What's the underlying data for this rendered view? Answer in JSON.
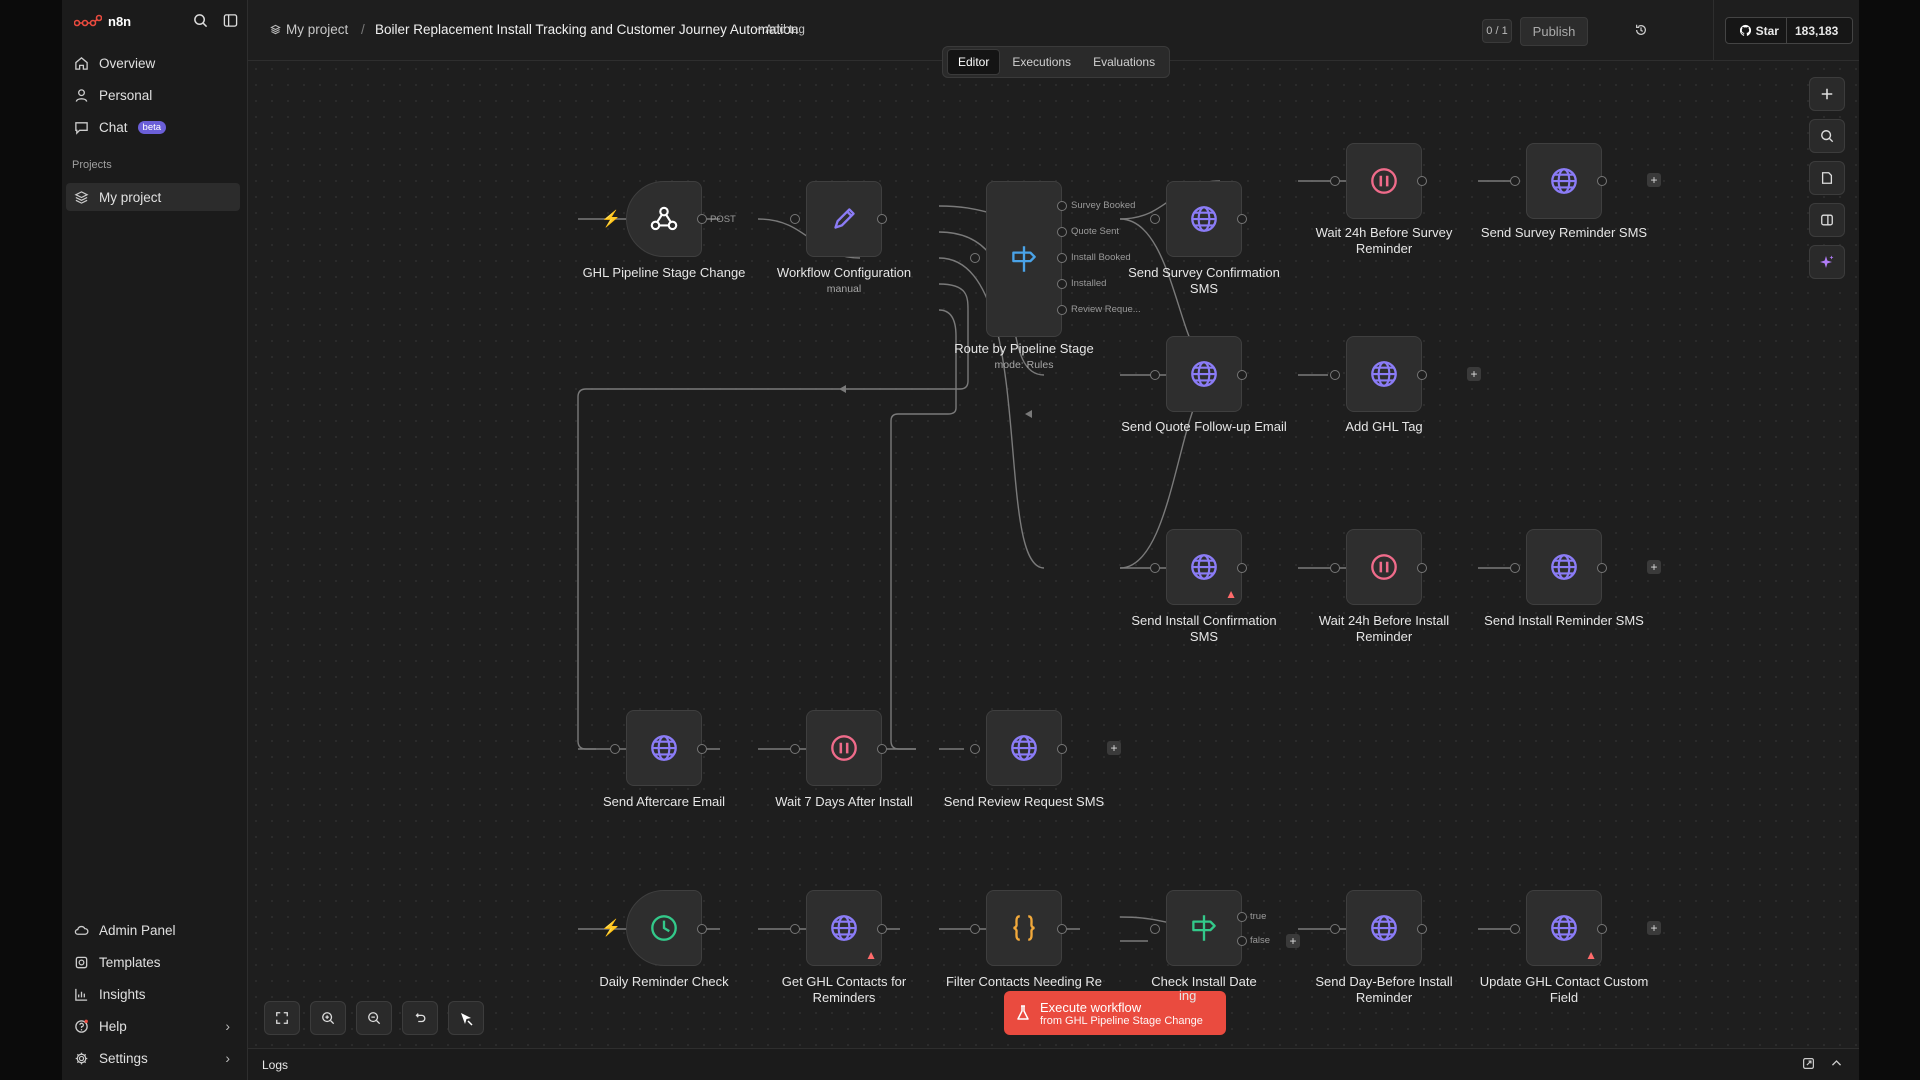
{
  "app": {
    "name": "n8n"
  },
  "sidebar": {
    "items": [
      {
        "label": "Overview",
        "icon": "home-icon"
      },
      {
        "label": "Personal",
        "icon": "user-icon"
      },
      {
        "label": "Chat",
        "icon": "chat-icon",
        "badge": "beta"
      }
    ],
    "projects_label": "Projects",
    "project_item": "My project",
    "bottom_items": [
      {
        "label": "Admin Panel",
        "icon": "cloud-icon"
      },
      {
        "label": "Templates",
        "icon": "templates-icon"
      },
      {
        "label": "Insights",
        "icon": "chart-icon"
      },
      {
        "label": "Help",
        "icon": "help-icon"
      },
      {
        "label": "Settings",
        "icon": "gear-icon"
      }
    ]
  },
  "header": {
    "project": "My project",
    "separator": "/",
    "workflow_name": "Boiler Replacement Install Tracking and Customer Journey Automation",
    "add_tag": "+ Add tag",
    "counter": "0 / 1",
    "publish": "Publish",
    "star": "Star",
    "star_count": "183,183"
  },
  "tabs": [
    "Editor",
    "Executions",
    "Evaluations"
  ],
  "nodes": {
    "ghl": {
      "label": "GHL Pipeline Stage Change",
      "icon": "webhook-icon"
    },
    "config": {
      "label": "Workflow Configuration",
      "sub": "manual",
      "icon": "pencil-icon"
    },
    "route": {
      "label": "Route by Pipeline Stage",
      "sub": "mode: Rules",
      "icon": "switch-icon"
    },
    "survey_sms": {
      "label": "Send Survey Confirmation SMS",
      "icon": "globe-icon"
    },
    "wait_survey": {
      "label": "Wait 24h Before Survey Reminder",
      "icon": "pause-icon"
    },
    "survey_reminder": {
      "label": "Send Survey Reminder SMS",
      "icon": "globe-icon"
    },
    "quote_email": {
      "label": "Send Quote Follow-up Email",
      "icon": "globe-icon"
    },
    "ghl_tag": {
      "label": "Add GHL Tag",
      "icon": "globe-icon"
    },
    "install_sms": {
      "label": "Send Install Confirmation SMS",
      "icon": "globe-icon"
    },
    "wait_install": {
      "label": "Wait 24h Before Install Reminder",
      "icon": "pause-icon"
    },
    "install_reminder": {
      "label": "Send Install Reminder SMS",
      "icon": "globe-icon"
    },
    "aftercare": {
      "label": "Send Aftercare Email",
      "icon": "globe-icon"
    },
    "wait7": {
      "label": "Wait 7 Days After Install",
      "icon": "pause-icon"
    },
    "review": {
      "label": "Send Review Request SMS",
      "icon": "globe-icon"
    },
    "daily": {
      "label": "Daily Reminder Check",
      "icon": "clock-icon"
    },
    "get_contacts": {
      "label": "Get GHL Contacts for Reminders",
      "icon": "globe-icon"
    },
    "filter": {
      "label": "Filter Contacts Needing Re",
      "icon": "code-icon"
    },
    "check_date": {
      "label": "Check Install Date",
      "label_tail": "ing",
      "icon": "if-icon"
    },
    "day_before": {
      "label": "Send Day-Before Install Reminder",
      "icon": "globe-icon"
    },
    "update_field": {
      "label": "Update GHL Contact Custom Field",
      "icon": "globe-icon"
    }
  },
  "edge_labels": {
    "post": "POST",
    "survey_booked": "Survey Booked",
    "quote_sent": "Quote Sent",
    "install_booked": "Install Booked",
    "installed": "Installed",
    "review_request": "Review Reque...",
    "true": "true",
    "false": "false"
  },
  "execute": {
    "title": "Execute workflow",
    "sub": "from GHL Pipeline Stage Change"
  },
  "logs": {
    "label": "Logs"
  },
  "colors": {
    "accent": "#ea4b3f",
    "globe": "#8b7cf6",
    "pause": "#ef6b8a",
    "switch": "#4aa3e8",
    "clock": "#33c98a",
    "code": "#f2a93b",
    "if": "#33c98a"
  }
}
